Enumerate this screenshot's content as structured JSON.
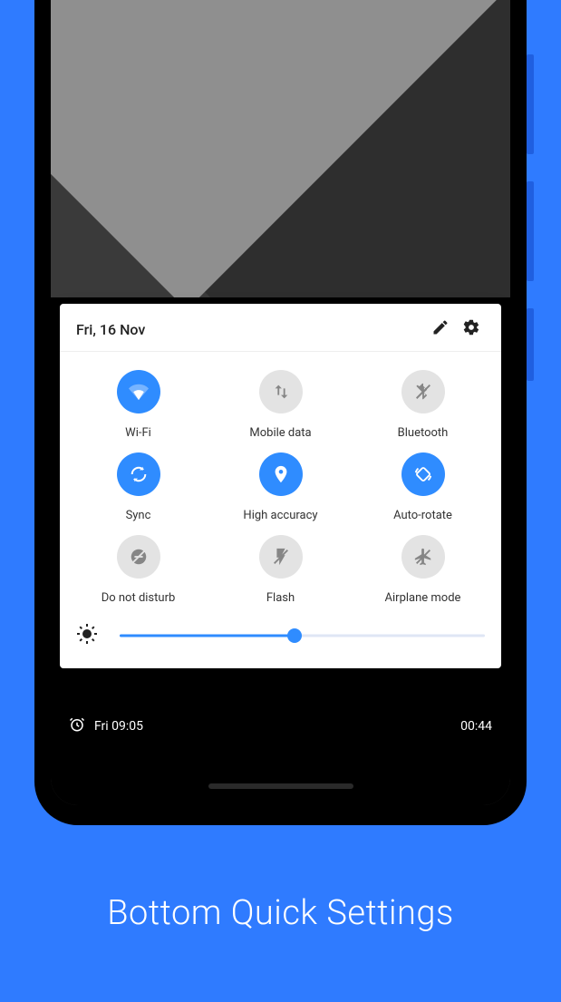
{
  "caption": "Bottom Quick Settings",
  "panel": {
    "date": "Fri, 16 Nov"
  },
  "tiles": [
    {
      "id": "wifi",
      "label": "Wi-Fi",
      "active": true
    },
    {
      "id": "mobile",
      "label": "Mobile data",
      "active": false
    },
    {
      "id": "bt",
      "label": "Bluetooth",
      "active": false
    },
    {
      "id": "sync",
      "label": "Sync",
      "active": true
    },
    {
      "id": "location",
      "label": "High accuracy",
      "active": true
    },
    {
      "id": "rotate",
      "label": "Auto-rotate",
      "active": true
    },
    {
      "id": "dnd",
      "label": "Do not disturb",
      "active": false
    },
    {
      "id": "flash",
      "label": "Flash",
      "active": false
    },
    {
      "id": "airplane",
      "label": "Airplane mode",
      "active": false
    }
  ],
  "brightness": {
    "percent": 48
  },
  "status": {
    "left_text": "Fri 09:05",
    "right_text": "00:44"
  }
}
